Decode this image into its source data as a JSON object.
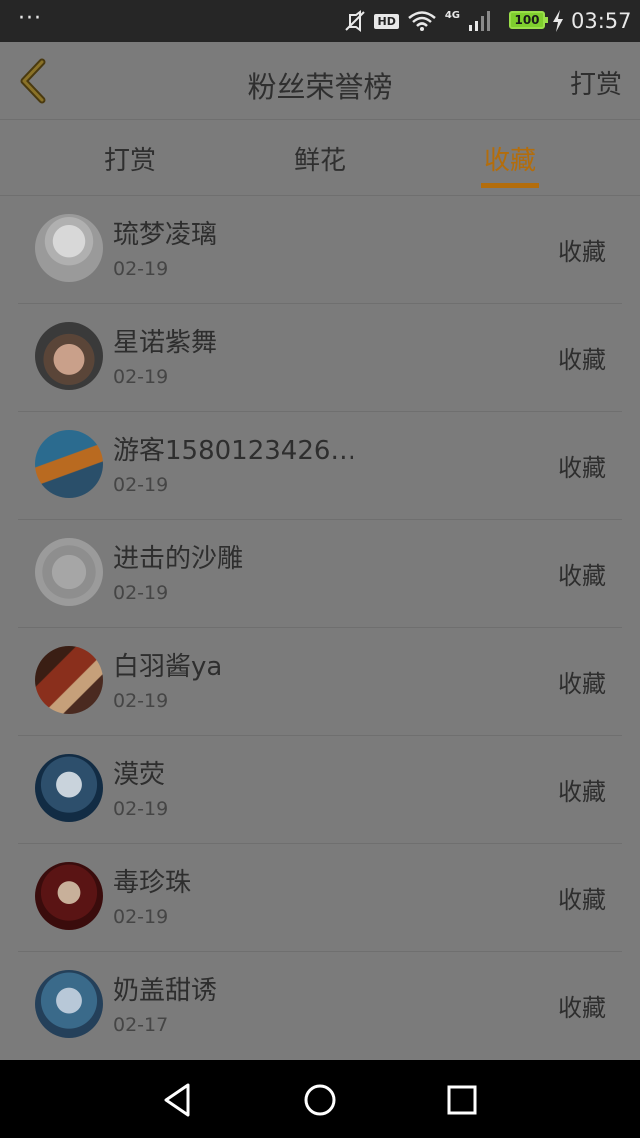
{
  "status": {
    "dots": "···",
    "hd": "HD",
    "network": "4G",
    "battery": "100",
    "time": "03:57",
    "icons": [
      "mute-icon",
      "wifi-icon",
      "signal-icon",
      "battery-icon",
      "charging-icon"
    ]
  },
  "header": {
    "title": "粉丝荣誉榜",
    "right_label": "打赏",
    "back_icon": "back-chevron-icon"
  },
  "tabs": [
    {
      "label": "打赏",
      "active": false
    },
    {
      "label": "鲜花",
      "active": false
    },
    {
      "label": "收藏",
      "active": true
    }
  ],
  "rows": [
    {
      "name": "琉梦凌璃",
      "date": "02-19",
      "type": "收藏"
    },
    {
      "name": "星诺紫舞",
      "date": "02-19",
      "type": "收藏"
    },
    {
      "name": "游客1580123426…",
      "date": "02-19",
      "type": "收藏"
    },
    {
      "name": "进击的沙雕",
      "date": "02-19",
      "type": "收藏"
    },
    {
      "name": "白羽酱ya",
      "date": "02-19",
      "type": "收藏"
    },
    {
      "name": "漠荧",
      "date": "02-19",
      "type": "收藏"
    },
    {
      "name": "毒珍珠",
      "date": "02-19",
      "type": "收藏"
    },
    {
      "name": "奶盖甜诱",
      "date": "02-17",
      "type": "收藏"
    }
  ],
  "colors": {
    "accent": "#b36d0c",
    "overlay_bg": "#7b7b7b",
    "statusbar": "#262626",
    "navbar": "#000000"
  }
}
